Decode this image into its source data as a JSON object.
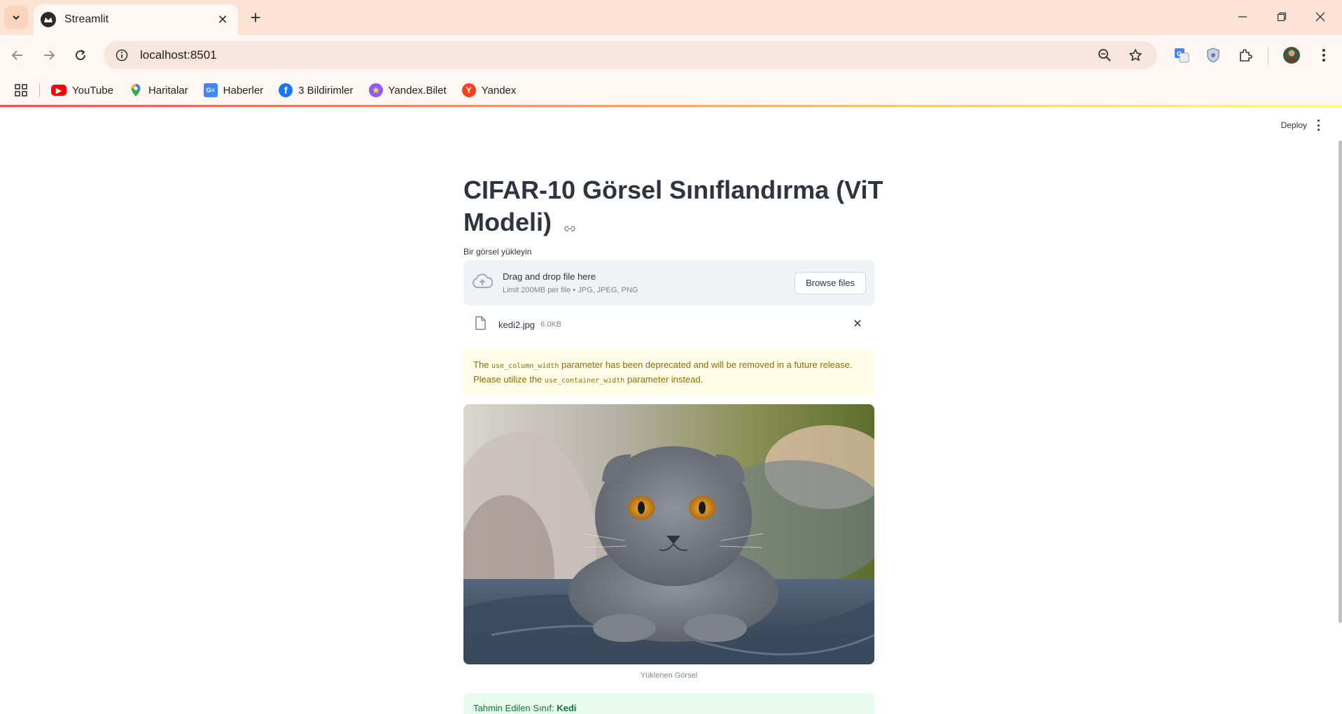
{
  "browser": {
    "tab_title": "Streamlit",
    "url": "localhost:8501",
    "bookmarks": [
      {
        "label": "YouTube",
        "icon": "youtube-icon",
        "color": "#ff0000"
      },
      {
        "label": "Haritalar",
        "icon": "maps-pin-icon",
        "color": "#34a853"
      },
      {
        "label": "Haberler",
        "icon": "news-icon",
        "color": "#4285f4"
      },
      {
        "label": "3 Bildirimler",
        "icon": "facebook-icon",
        "color": "#1877f2"
      },
      {
        "label": "Yandex.Bilet",
        "icon": "yandex-bilet-icon",
        "color": "#8b5cf6"
      },
      {
        "label": "Yandex",
        "icon": "yandex-icon",
        "color": "#fc3f1d"
      }
    ]
  },
  "app": {
    "deploy_label": "Deploy",
    "title_line1": "CIFAR-10 Görsel Sınıflandırma (ViT",
    "title_line2": "Modeli)",
    "uploader": {
      "label": "Bir görsel yükleyin",
      "drag_text": "Drag and drop file here",
      "limit_text": "Limit 200MB per file • JPG, JPEG, PNG",
      "browse_label": "Browse files"
    },
    "file": {
      "name": "kedi2.jpg",
      "size": "6.0KB"
    },
    "warning": {
      "part1": "The ",
      "code1": "use_column_width",
      "part2": " parameter has been deprecated and will be removed in a future release. Please utilize the ",
      "code2": "use_container_width",
      "part3": " parameter instead."
    },
    "image_caption": "Yüklenen Görsel",
    "result": {
      "prefix": "Tahmin Edilen Sınıf: ",
      "value": "Kedi"
    }
  },
  "colors": {
    "accent": "#ff4b4b",
    "warning_bg": "#fffce7",
    "warning_text": "#926c05",
    "success_bg": "#e8f9ee",
    "success_text": "#177233"
  }
}
